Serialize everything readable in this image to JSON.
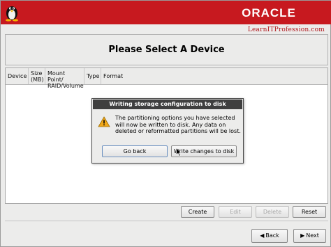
{
  "header": {
    "brand": "ORACLE",
    "site": "LearnITProfession.com"
  },
  "page": {
    "title": "Please Select A Device"
  },
  "table": {
    "columns": {
      "device": "Device",
      "size_line1": "Size",
      "size_line2": "(MB)",
      "mount_line1": "Mount Point/",
      "mount_line2": "RAID/Volume",
      "type": "Type",
      "format": "Format"
    }
  },
  "dialog": {
    "title": "Writing storage configuration to disk",
    "message": "The partitioning options you have selected will now be written to disk.  Any data on deleted or reformatted partitions will be lost.",
    "go_back_label": "Go back",
    "write_label": "Write changes to disk"
  },
  "actions": {
    "create": "Create",
    "edit": "Edit",
    "delete": "Delete",
    "reset": "Reset"
  },
  "nav": {
    "back": "Back",
    "next": "Next"
  },
  "colors": {
    "brand_red": "#c7191f",
    "dialog_title_bg": "#3f3f3f"
  },
  "icons": {
    "os_logo": "tux-penguin-icon",
    "warning": "warning-icon",
    "back": "arrow-left-icon",
    "next": "arrow-right-icon",
    "pointer": "mouse-cursor-icon"
  }
}
